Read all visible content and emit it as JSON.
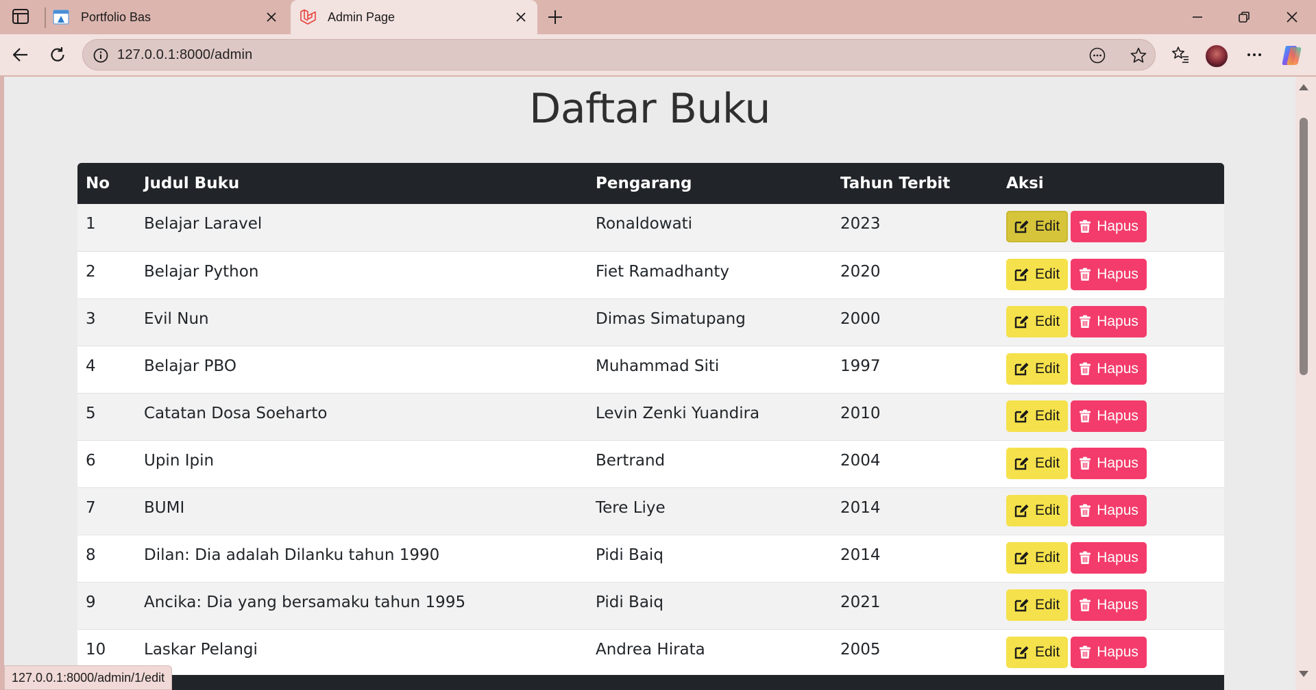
{
  "browser": {
    "tabs": [
      {
        "title": "Portfolio Bas",
        "favicon": "portfolio-favicon",
        "active": false
      },
      {
        "title": "Admin Page",
        "favicon": "laravel-favicon",
        "active": true
      }
    ],
    "url": "127.0.0.1:8000/admin",
    "status_url": "127.0.0.1:8000/admin/1/edit"
  },
  "page": {
    "title": "Daftar Buku",
    "table": {
      "headers": [
        "No",
        "Judul Buku",
        "Pengarang",
        "Tahun Terbit",
        "Aksi"
      ],
      "rows": [
        {
          "no": "1",
          "title": "Belajar Laravel",
          "author": "Ronaldowati",
          "year": "2023"
        },
        {
          "no": "2",
          "title": "Belajar Python",
          "author": "Fiet Ramadhanty",
          "year": "2020"
        },
        {
          "no": "3",
          "title": "Evil Nun",
          "author": "Dimas Simatupang",
          "year": "2000"
        },
        {
          "no": "4",
          "title": "Belajar PBO",
          "author": "Muhammad Siti",
          "year": "1997"
        },
        {
          "no": "5",
          "title": "Catatan Dosa Soeharto",
          "author": "Levin Zenki Yuandira",
          "year": "2010"
        },
        {
          "no": "6",
          "title": "Upin Ipin",
          "author": "Bertrand",
          "year": "2004"
        },
        {
          "no": "7",
          "title": "BUMI",
          "author": "Tere Liye",
          "year": "2014"
        },
        {
          "no": "8",
          "title": "Dilan: Dia adalah Dilanku tahun 1990",
          "author": "Pidi Baiq",
          "year": "2014"
        },
        {
          "no": "9",
          "title": "Ancika: Dia yang bersamaku tahun 1995",
          "author": "Pidi Baiq",
          "year": "2021"
        },
        {
          "no": "10",
          "title": "Laskar Pelangi",
          "author": "Andrea Hirata",
          "year": "2005"
        }
      ],
      "edit_label": "Edit",
      "delete_label": "Hapus",
      "hovered_row": 0
    }
  },
  "colors": {
    "header_bg": "#212529",
    "edit_button": "#f5e14b",
    "delete_button": "#f33c6b",
    "browser_frame": "#dcb5af"
  }
}
